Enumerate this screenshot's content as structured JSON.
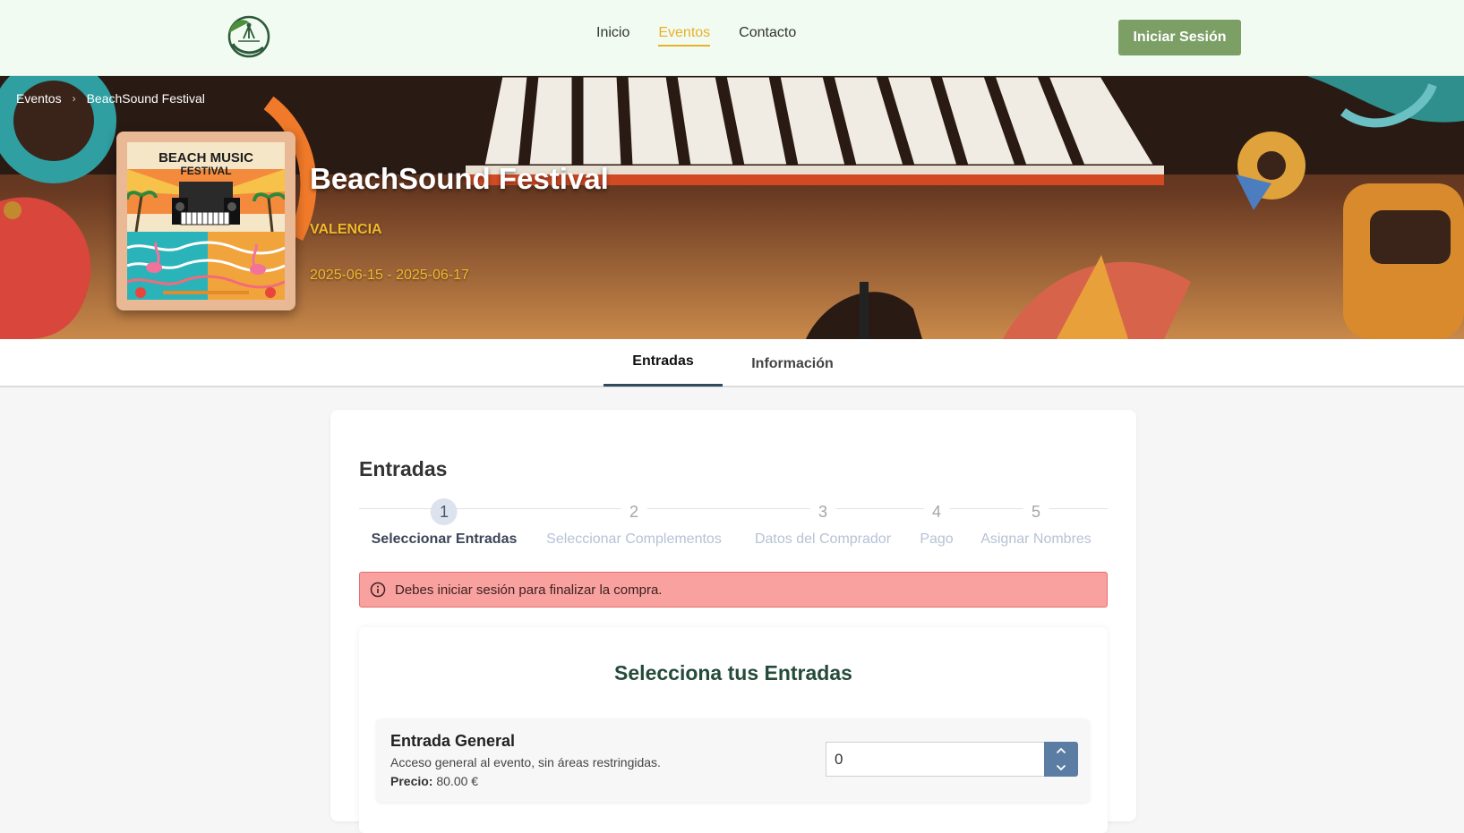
{
  "header": {
    "logo_icon": "leaf-logo-icon",
    "nav": [
      {
        "label": "Inicio",
        "active": false
      },
      {
        "label": "Eventos",
        "active": true
      },
      {
        "label": "Contacto",
        "active": false
      }
    ],
    "login_label": "Iniciar Sesión"
  },
  "breadcrumb": {
    "items": [
      "Eventos",
      "BeachSound Festival"
    ],
    "separator_icon": "chevron-right-icon"
  },
  "event": {
    "title": "BeachSound Festival",
    "city": "VALENCIA",
    "dates": "2025-06-15 - 2025-06-17",
    "poster": {
      "headline_line1": "BEACH MUSIC",
      "headline_line2": "FESTIVAL"
    }
  },
  "tabs": [
    {
      "label": "Entradas",
      "active": true
    },
    {
      "label": "Información",
      "active": false
    }
  ],
  "section": {
    "title": "Entradas",
    "steps": [
      {
        "number": "1",
        "label": "Seleccionar Entradas",
        "current": true
      },
      {
        "number": "2",
        "label": "Seleccionar Complementos",
        "current": false
      },
      {
        "number": "3",
        "label": "Datos del Comprador",
        "current": false
      },
      {
        "number": "4",
        "label": "Pago",
        "current": false
      },
      {
        "number": "5",
        "label": "Asignar Nombres",
        "current": false
      }
    ],
    "alert": {
      "icon": "info-circle-icon",
      "text": "Debes iniciar sesión para finalizar la compra."
    },
    "selector": {
      "title": "Selecciona tus Entradas",
      "tickets": [
        {
          "name": "Entrada General",
          "description": "Acceso general al evento, sin áreas restringidas.",
          "price_label": "Precio:",
          "price_value": "80.00 €",
          "quantity": "0"
        }
      ]
    }
  },
  "colors": {
    "header_bg": "#f1fbf1",
    "accent_yellow": "#e8b12a",
    "login_button": "#7c9f66",
    "alert_bg": "#f8a19e",
    "heading_green": "#254b3a",
    "spinner_blue": "#5b7da3"
  }
}
